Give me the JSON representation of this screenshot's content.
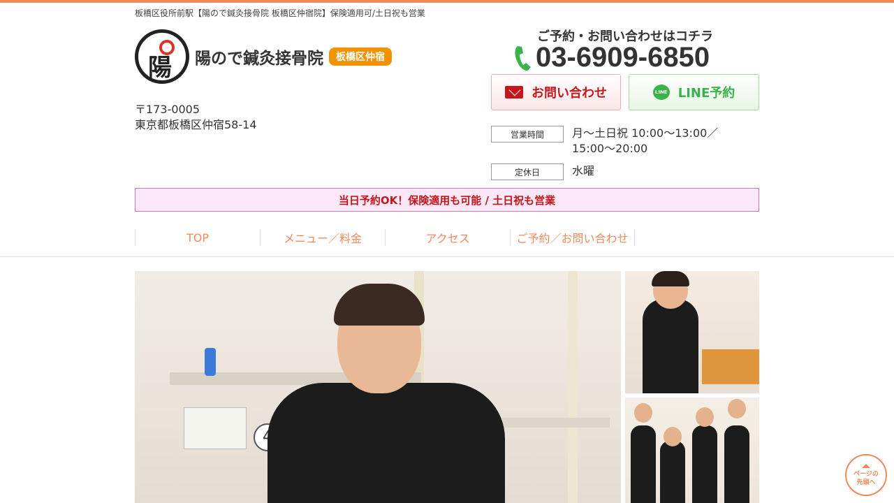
{
  "header": {
    "tagline": "板橋区役所前駅【陽ので鍼灸接骨院 板橋区仲宿院】保険適用可/土日祝も営業",
    "logo_text": "陽ので鍼灸接骨院",
    "logo_badge": "板橋区仲宿",
    "logo_glyph": "陽",
    "postal": "〒173-0005",
    "address": "東京都板橋区仲宿58-14"
  },
  "contact": {
    "heading": "ご予約・お問い合わせはコチラ",
    "phone": "03-6909-6850",
    "mail_button": "お問い合わせ",
    "line_button": "LINE予約",
    "line_icon_text": "LINE"
  },
  "hours": {
    "label": "営業時間",
    "value": "月〜土日祝 10:00〜13:00／15:00〜20:00",
    "closed_label": "定休日",
    "closed_value": "水曜"
  },
  "notice": "当日予約OK！保険適用も可能 / 土日祝も営業",
  "nav": {
    "items": [
      {
        "label": "TOP"
      },
      {
        "label": "メニュー／料金"
      },
      {
        "label": "アクセス"
      },
      {
        "label": "ご予約／お問い合わせ"
      }
    ]
  },
  "hero": {
    "badge": "4"
  },
  "pagetop": {
    "line1": "ページの",
    "line2": "先頭へ"
  },
  "colors": {
    "accent": "#f08a5d",
    "brand_orange": "#f39200",
    "mail_red": "#c4161c",
    "line_green": "#39b34a",
    "notice_bg": "#fbe7f5"
  }
}
